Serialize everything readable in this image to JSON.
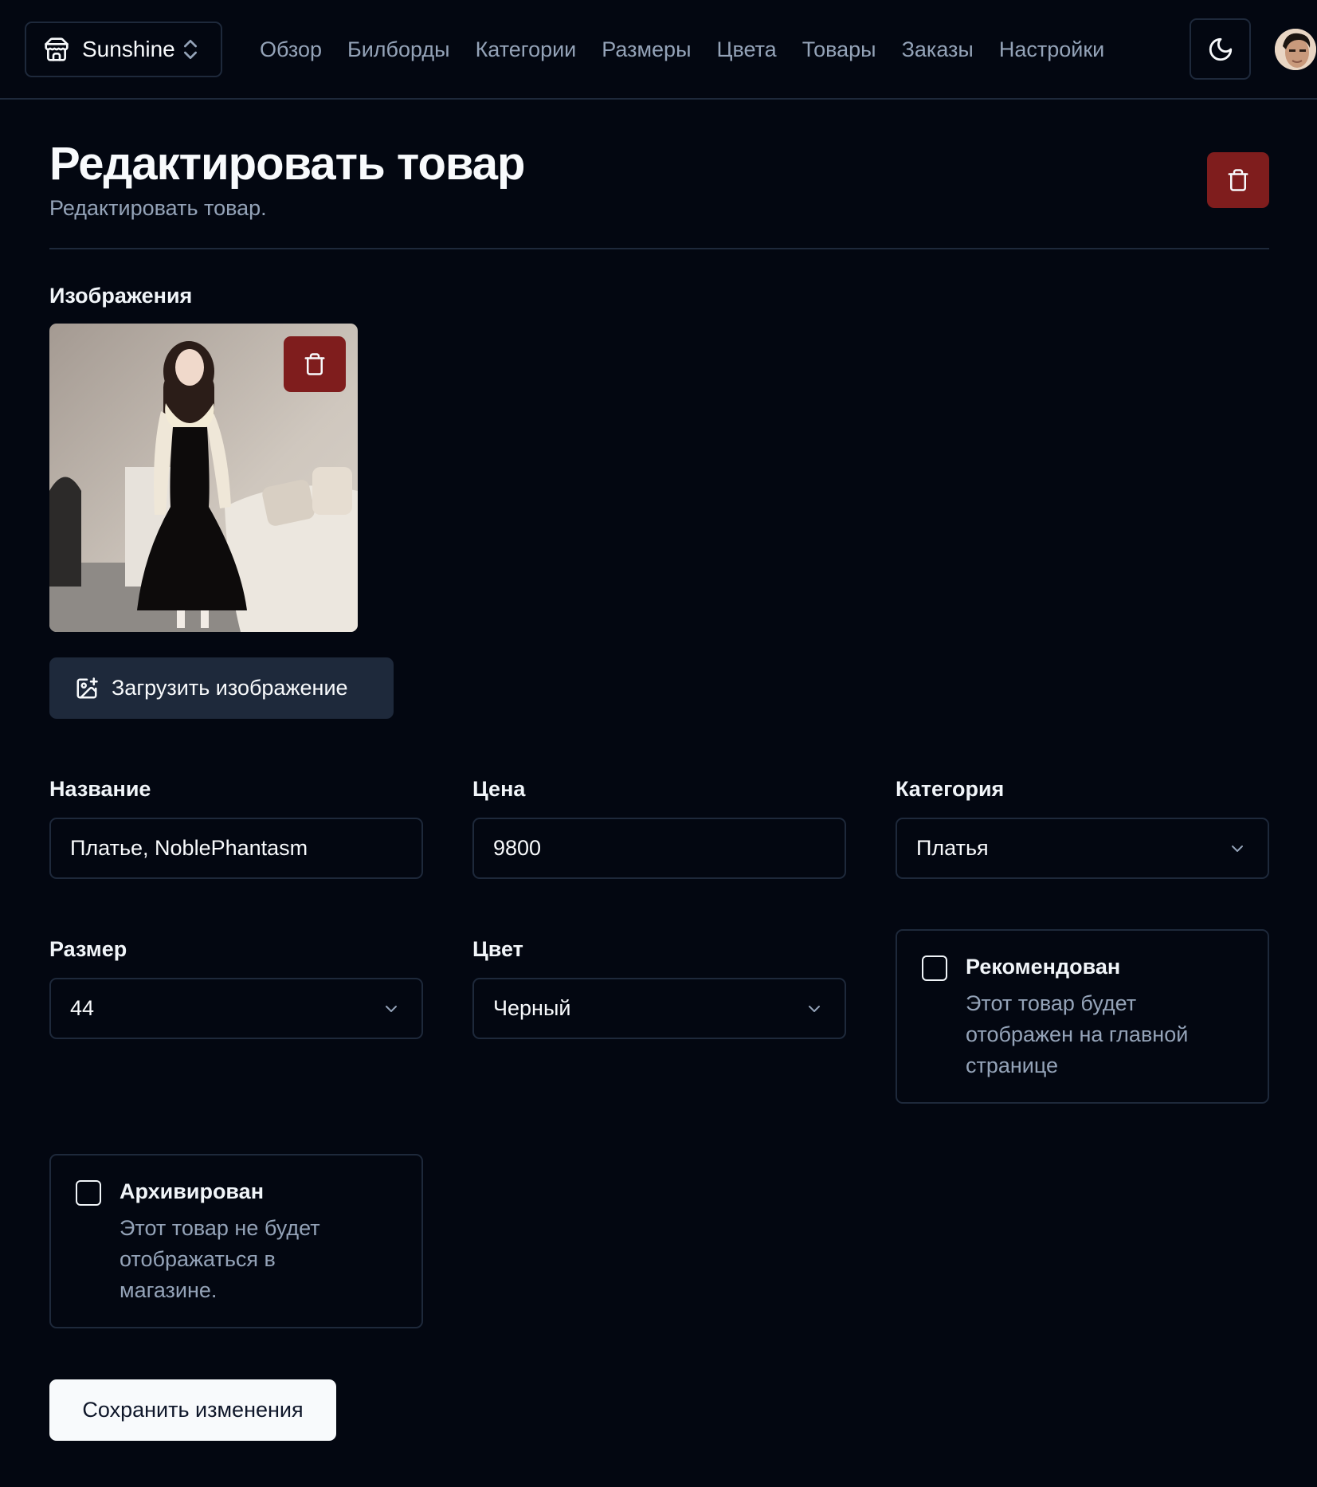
{
  "topbar": {
    "store_name": "Sunshine",
    "nav": [
      "Обзор",
      "Билборды",
      "Категории",
      "Размеры",
      "Цвета",
      "Товары",
      "Заказы",
      "Настройки"
    ]
  },
  "heading": {
    "title": "Редактировать товар",
    "description": "Редактировать товар."
  },
  "images": {
    "label": "Изображения",
    "upload_label": "Загрузить изображение"
  },
  "form": {
    "name_label": "Название",
    "name_value": "Платье, NoblePhantasm",
    "price_label": "Цена",
    "price_value": "9800",
    "category_label": "Категория",
    "category_value": "Платья",
    "size_label": "Размер",
    "size_value": "44",
    "color_label": "Цвет",
    "color_value": "Черный",
    "featured_title": "Рекомендован",
    "featured_desc": "Этот товар будет отображен на главной странице",
    "featured_checked": false,
    "archived_title": "Архивирован",
    "archived_desc": "Этот товар не будет отображаться в магазине.",
    "archived_checked": false,
    "save_label": "Сохранить изменения"
  },
  "colors": {
    "background": "#030711",
    "border": "#1e293b",
    "muted_text": "#94a3b8",
    "danger": "#7f1d1d"
  }
}
